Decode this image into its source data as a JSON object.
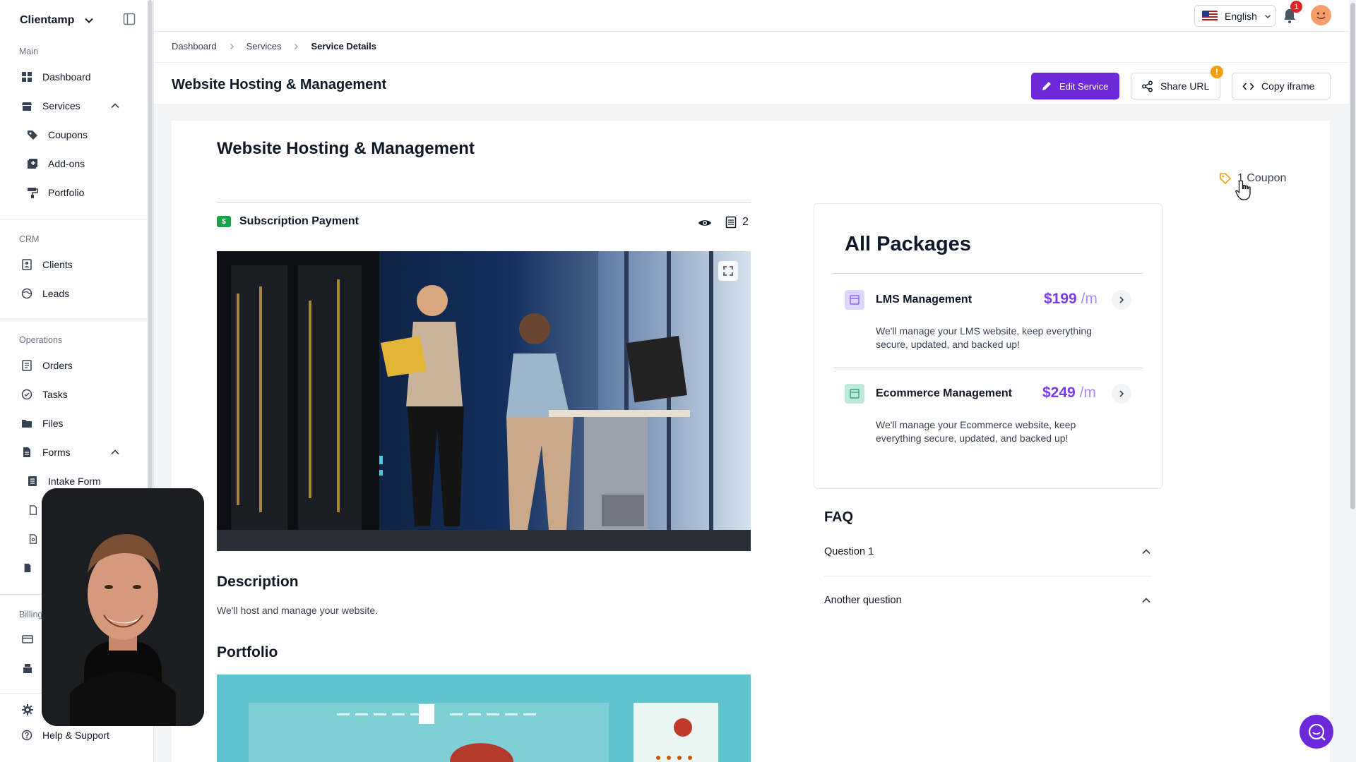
{
  "sidebar": {
    "brand": "Clientamp",
    "sections": {
      "main": "Main",
      "crm": "CRM",
      "operations": "Operations",
      "billing": "Billing"
    },
    "items": {
      "dashboard": "Dashboard",
      "services": "Services",
      "coupons": "Coupons",
      "addons": "Add-ons",
      "portfolio": "Portfolio",
      "clients": "Clients",
      "leads": "Leads",
      "orders": "Orders",
      "tasks": "Tasks",
      "files": "Files",
      "forms": "Forms",
      "intake_form": "Intake Form",
      "help": "Help & Support"
    }
  },
  "topbar": {
    "language": "English",
    "notification_count": "1"
  },
  "breadcrumb": [
    "Dashboard",
    "Services",
    "Service Details"
  ],
  "header": {
    "title": "Website Hosting & Management",
    "edit_button": "Edit Service",
    "share_button": "Share URL",
    "share_badge": "!",
    "iframe_button": "Copy iframe"
  },
  "service": {
    "title": "Website Hosting & Management",
    "coupon_label": "1 Coupon",
    "payment_type": "Subscription Payment",
    "payment_icon": "$",
    "package_count": "2",
    "description_heading": "Description",
    "description": "We'll host and manage your website.",
    "portfolio_heading": "Portfolio"
  },
  "packages": {
    "title": "All Packages",
    "items": [
      {
        "name": "LMS Management",
        "price": "$199",
        "period": "/m",
        "description": "We'll manage your LMS website, keep everything secure, updated, and backed up!",
        "icon_color": "#c4b5fd"
      },
      {
        "name": "Ecommerce Management",
        "price": "$249",
        "period": "/m",
        "description": "We'll manage your Ecommerce website, keep everything secure, updated, and backed up!",
        "icon_color": "#86d1b8"
      }
    ]
  },
  "faq": {
    "title": "FAQ",
    "questions": [
      "Question 1",
      "Another question"
    ]
  },
  "colors": {
    "accent": "#6d28d9",
    "price": "#7c3aed",
    "warning": "#f59e0b",
    "danger": "#dc2626"
  }
}
